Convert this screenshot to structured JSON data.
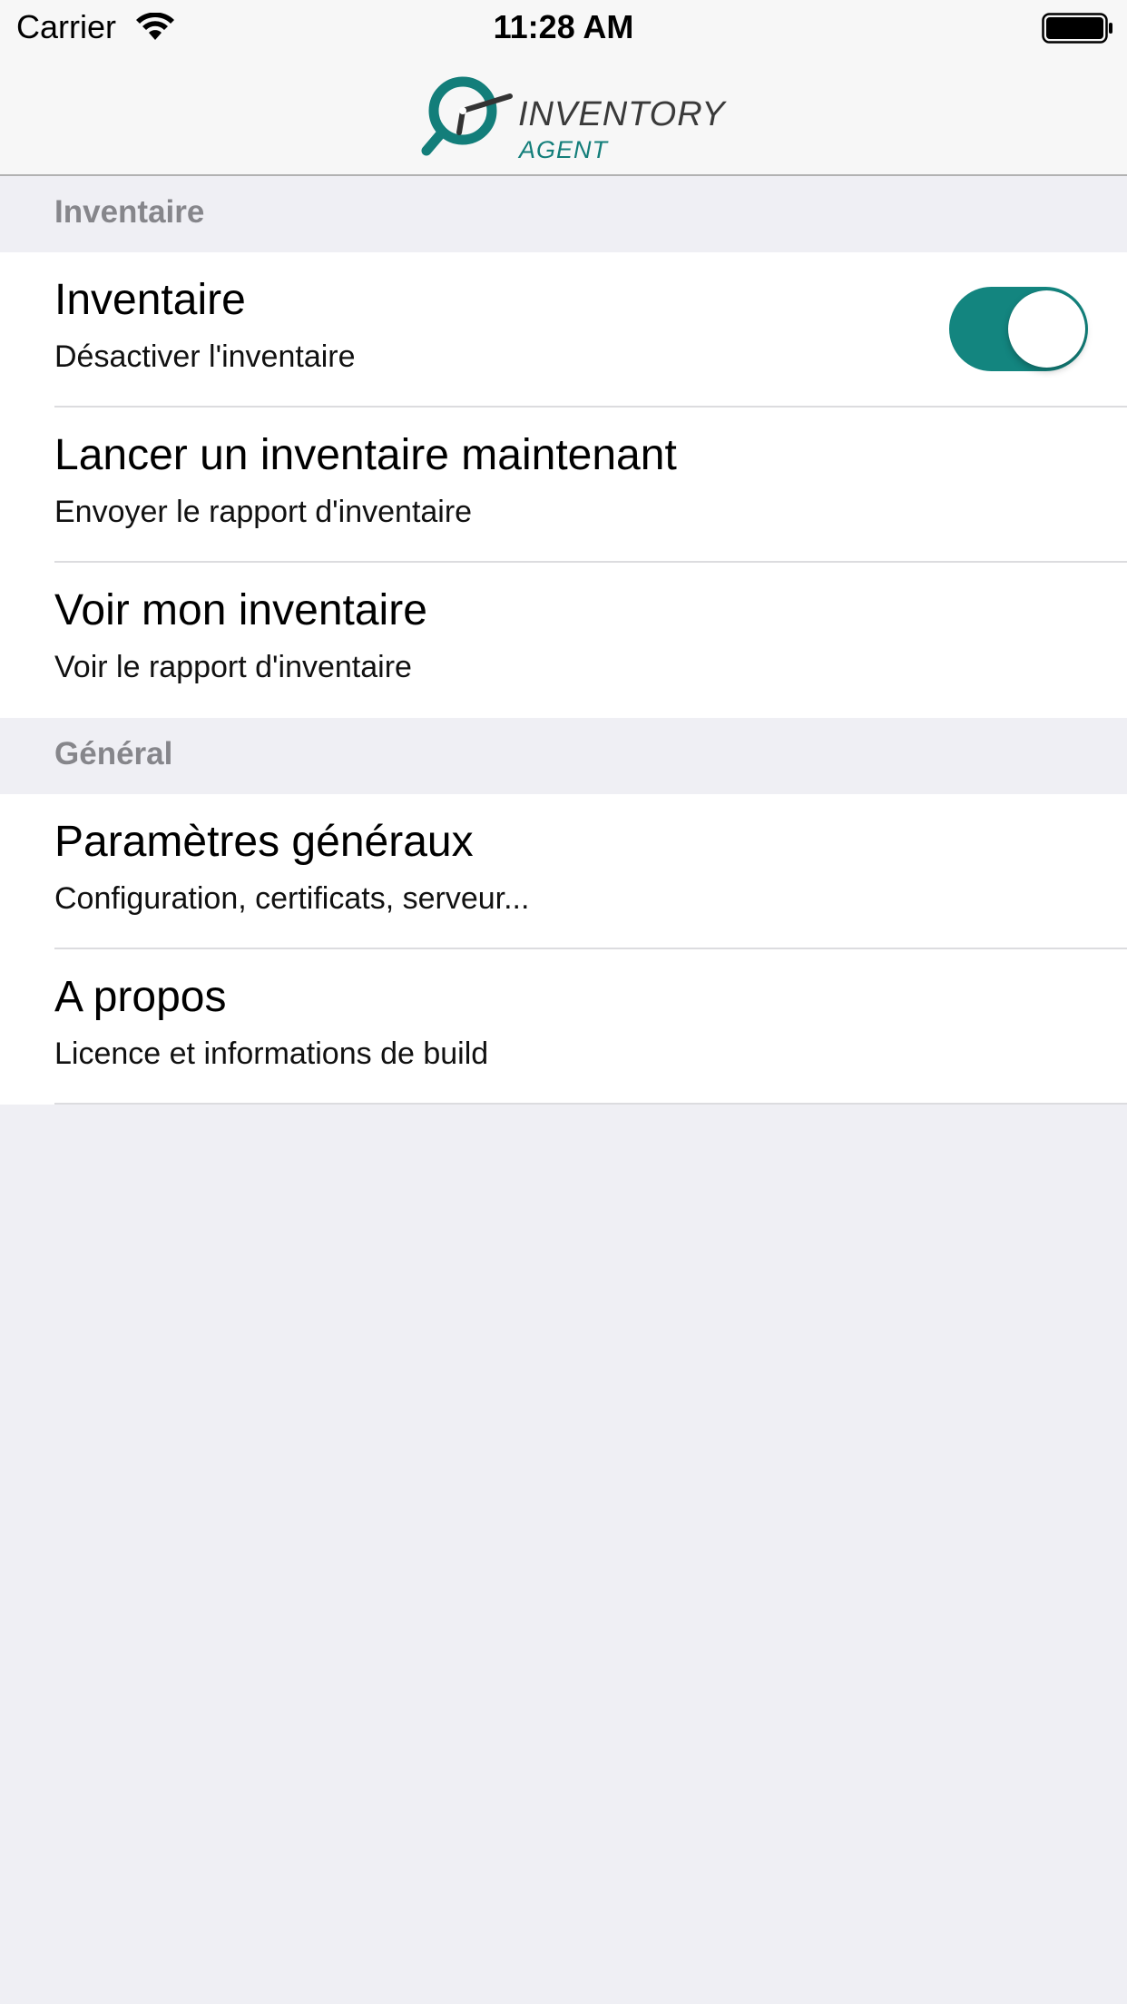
{
  "status_bar": {
    "carrier": "Carrier",
    "time": "11:28 AM",
    "wifi_icon": "wifi-icon",
    "battery_icon": "battery-full-icon"
  },
  "nav_bar": {
    "logo_icon": "magnifier-clock-logo",
    "logo_line1": "INVENTORY",
    "logo_line2": "AGENT"
  },
  "colors": {
    "accent": "#137e7a",
    "toggle_on": "#13857f",
    "section_header_text": "#86868b",
    "background": "#efeff4"
  },
  "sections": [
    {
      "header": "Inventaire",
      "items": [
        {
          "title": "Inventaire",
          "subtitle": "Désactiver l'inventaire",
          "toggle_on": true
        },
        {
          "title": "Lancer un inventaire maintenant",
          "subtitle": "Envoyer le rapport d'inventaire"
        },
        {
          "title": "Voir mon inventaire",
          "subtitle": "Voir le rapport d'inventaire"
        }
      ]
    },
    {
      "header": "Général",
      "items": [
        {
          "title": "Paramètres généraux",
          "subtitle": "Configuration, certificats, serveur..."
        },
        {
          "title": "A propos",
          "subtitle": "Licence et informations de build"
        }
      ]
    }
  ]
}
